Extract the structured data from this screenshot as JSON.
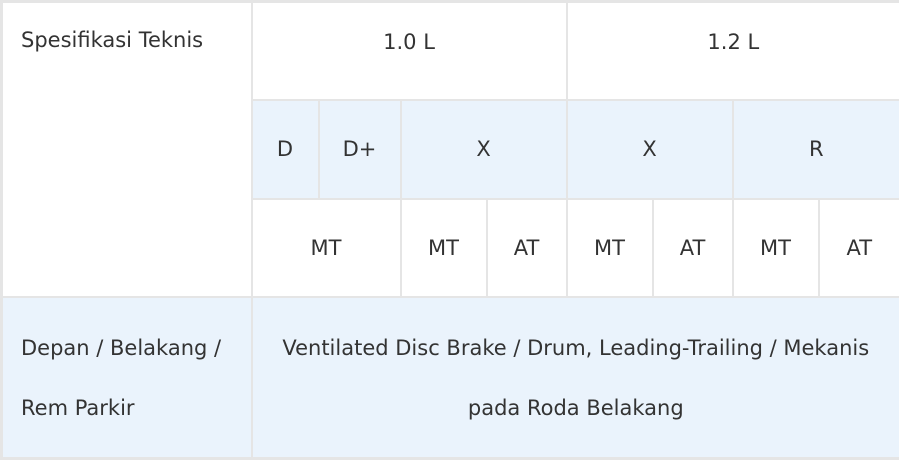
{
  "table": {
    "spec_label": "Spesifikasi Teknis",
    "engines": [
      "1.0 L",
      "1.2 L"
    ],
    "variants": [
      "D",
      "D+",
      "X",
      "X",
      "R"
    ],
    "transmissions": [
      "MT",
      "MT",
      "AT",
      "MT",
      "AT",
      "MT",
      "AT"
    ],
    "brake_label_line1": "Depan / Belakang /",
    "brake_label_line2": "Rem Parkir",
    "brake_value_line1": "Ventilated Disc Brake / Drum, Leading-Trailing / Mekanis",
    "brake_value_line2": "pada Roda Belakang"
  },
  "colors": {
    "border": "#e5e5e5",
    "highlight_background": "#eaf3fc",
    "text": "#333333"
  }
}
